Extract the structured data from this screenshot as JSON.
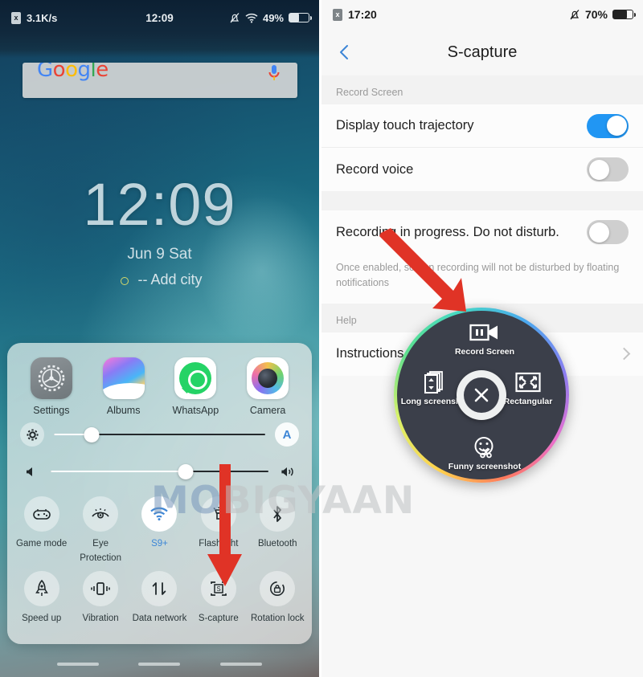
{
  "left_phone": {
    "status_bar": {
      "sim_icon": "no-sim-icon",
      "network_speed": "3.1K/s",
      "time": "12:09",
      "mute_icon": "bell-mute-icon",
      "wifi_icon": "wifi-icon",
      "battery_percent": "49%",
      "battery_level": 49
    },
    "google_widget": {
      "logo": "Google",
      "mic_icon": "microphone-icon"
    },
    "lock_screen": {
      "time": "12:09",
      "date": "Jun 9  Sat",
      "weather_icon": "sun-icon",
      "weather": "-- Add city"
    },
    "control_center": {
      "apps": [
        {
          "label": "Settings",
          "icon": "settings-gear-icon"
        },
        {
          "label": "Albums",
          "icon": "albums-icon"
        },
        {
          "label": "WhatsApp",
          "icon": "whatsapp-icon"
        },
        {
          "label": "Camera",
          "icon": "camera-icon"
        }
      ],
      "brightness": {
        "icon": "brightness-gear-icon",
        "value": 18,
        "auto_label": "A"
      },
      "volume": {
        "icon_low": "volume-low-icon",
        "icon_high": "volume-high-icon",
        "value": 62
      },
      "toggles_row1": [
        {
          "label": "Game mode",
          "icon": "game-mode-icon",
          "active": false
        },
        {
          "label": "Eye Protection",
          "icon": "eye-protection-icon",
          "active": false
        },
        {
          "label": "S9+",
          "icon": "wifi-icon",
          "active": true
        },
        {
          "label": "Flashlight",
          "icon": "flashlight-icon",
          "active": false
        },
        {
          "label": "Bluetooth",
          "icon": "bluetooth-icon",
          "active": false
        }
      ],
      "toggles_row2": [
        {
          "label": "Speed up",
          "icon": "rocket-icon",
          "active": false
        },
        {
          "label": "Vibration",
          "icon": "vibration-icon",
          "active": false
        },
        {
          "label": "Data network",
          "icon": "data-network-icon",
          "active": false
        },
        {
          "label": "S-capture",
          "icon": "s-capture-icon",
          "active": false
        },
        {
          "label": "Rotation lock",
          "icon": "rotation-lock-icon",
          "active": false
        }
      ]
    }
  },
  "right_phone": {
    "status_bar": {
      "sim_icon": "no-sim-icon",
      "time": "17:20",
      "mute_icon": "bell-mute-icon",
      "battery_percent": "70%",
      "battery_level": 70
    },
    "header": {
      "back_icon": "back-chevron-icon",
      "title": "S-capture"
    },
    "sections": [
      {
        "title": "Record Screen",
        "rows": [
          {
            "label": "Display touch trajectory",
            "toggle": true
          },
          {
            "label": "Record voice",
            "toggle": false
          }
        ]
      },
      {
        "title": "",
        "rows": [
          {
            "label": "Recording in progress. Do not disturb.",
            "toggle": false
          }
        ],
        "hint": "Once enabled, screen recording will not be disturbed by floating notifications"
      },
      {
        "title": "Help",
        "rows": [
          {
            "label": "Instructions",
            "chevron": "chevron-right-icon"
          }
        ]
      }
    ],
    "radial_menu": {
      "items": [
        {
          "label": "Record Screen",
          "icon": "video-record-icon",
          "position": "top"
        },
        {
          "label": "Long screenshot",
          "icon": "long-screenshot-icon",
          "position": "left"
        },
        {
          "label": "Rectangular",
          "icon": "rectangular-crop-icon",
          "position": "right"
        },
        {
          "label": "Funny screenshot",
          "icon": "funny-screenshot-icon",
          "position": "bottom"
        }
      ],
      "close_icon": "close-x-icon",
      "ring_colors": [
        "#ffd24d",
        "#5ce08f",
        "#4aa9ee",
        "#8a7df0",
        "#e86fd0"
      ]
    }
  },
  "annotations": {
    "arrow_color": "#e03326",
    "arrow_left_target": "S-capture",
    "arrow_right_target": "Record Screen"
  },
  "watermark": {
    "text_accent": "MO",
    "text_rest": "BIGYAAN"
  }
}
